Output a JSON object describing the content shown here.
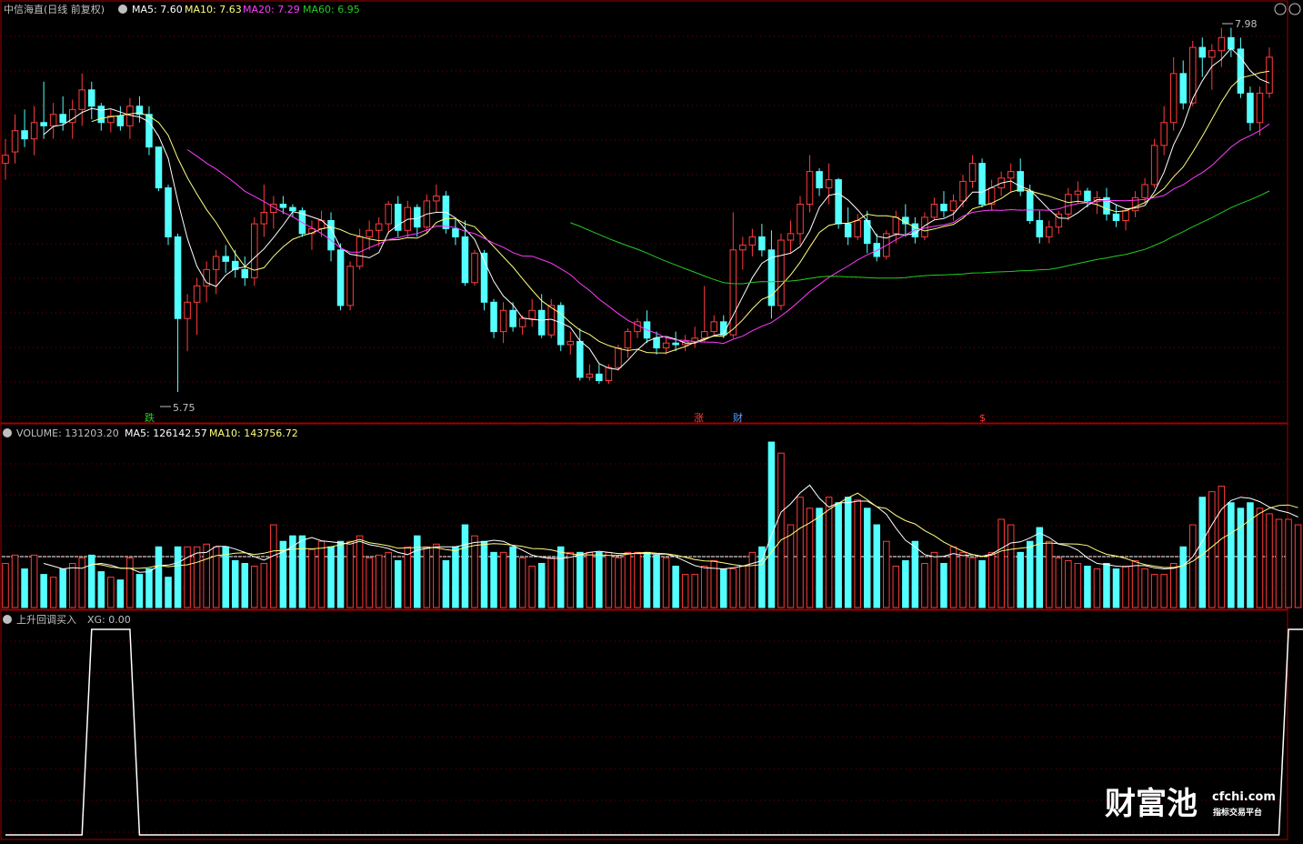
{
  "colors": {
    "up": "#ff3c3c",
    "down": "#54ffff",
    "ma5": "#ffffff",
    "ma10": "#ffff7f",
    "ma20": "#ff3cff",
    "ma60": "#22cc22",
    "frame": "#a00000",
    "grid": "#7a0000",
    "text_label": "#c0c0c0"
  },
  "price_panel": {
    "title": "中信海直(日线 前复权)",
    "legend": [
      {
        "name": "MA5",
        "text": "MA5: 7.60",
        "color": "#ffffff"
      },
      {
        "name": "MA10",
        "text": "MA10: 7.63",
        "color": "#ffff7f"
      },
      {
        "name": "MA20",
        "text": "MA20: 7.29",
        "color": "#ff3cff"
      },
      {
        "name": "MA60",
        "text": "MA60: 6.95",
        "color": "#22cc22"
      }
    ],
    "high_label": "7.98",
    "low_label": "5.75",
    "markers": [
      {
        "text": "跌",
        "color": "#22cc22"
      },
      {
        "text": "涨",
        "color": "#ff3c3c"
      },
      {
        "text": "财",
        "color": "#54a0ff"
      },
      {
        "text": "$",
        "color": "#ff3c3c"
      }
    ]
  },
  "volume_panel": {
    "legend": [
      {
        "name": "VOLUME",
        "text": "VOLUME: 131203.20",
        "color": "#c0c0c0"
      },
      {
        "name": "MA5",
        "text": "MA5: 126142.57",
        "color": "#ffffff"
      },
      {
        "name": "MA10",
        "text": "MA10: 143756.72",
        "color": "#ffff7f"
      }
    ]
  },
  "indicator_panel": {
    "legend": [
      {
        "name": "title",
        "text": "上升回调买入",
        "color": "#c0c0c0"
      },
      {
        "name": "XG",
        "text": "XG: 0.00",
        "color": "#c0c0c0"
      }
    ]
  },
  "watermark": {
    "brand": "财富池",
    "domain": "cfchi.com",
    "slogan": "指标交易平台"
  },
  "chart_data": [
    {
      "type": "candlestick",
      "title": "中信海直(日线 前复权)",
      "ylim": [
        5.6,
        8.05
      ],
      "up_color": "#ff3c3c",
      "down_color": "#54ffff",
      "ohlc": [
        [
          7.15,
          7.3,
          7.05,
          7.2
        ],
        [
          7.22,
          7.45,
          7.15,
          7.35
        ],
        [
          7.35,
          7.48,
          7.25,
          7.3
        ],
        [
          7.3,
          7.5,
          7.2,
          7.4
        ],
        [
          7.4,
          7.65,
          7.3,
          7.38
        ],
        [
          7.38,
          7.52,
          7.3,
          7.45
        ],
        [
          7.45,
          7.56,
          7.35,
          7.4
        ],
        [
          7.4,
          7.54,
          7.3,
          7.48
        ],
        [
          7.48,
          7.7,
          7.38,
          7.6
        ],
        [
          7.6,
          7.65,
          7.42,
          7.5
        ],
        [
          7.5,
          7.52,
          7.35,
          7.4
        ],
        [
          7.4,
          7.48,
          7.34,
          7.44
        ],
        [
          7.44,
          7.5,
          7.35,
          7.38
        ],
        [
          7.38,
          7.55,
          7.3,
          7.5
        ],
        [
          7.5,
          7.56,
          7.4,
          7.45
        ],
        [
          7.45,
          7.5,
          7.2,
          7.25
        ],
        [
          7.25,
          7.25,
          6.98,
          7.0
        ],
        [
          7.0,
          7.02,
          6.65,
          6.7
        ],
        [
          6.7,
          6.72,
          5.75,
          6.2
        ],
        [
          6.2,
          6.35,
          6.0,
          6.3
        ],
        [
          6.3,
          6.45,
          6.1,
          6.4
        ],
        [
          6.4,
          6.55,
          6.3,
          6.5
        ],
        [
          6.5,
          6.62,
          6.35,
          6.58
        ],
        [
          6.58,
          6.65,
          6.48,
          6.55
        ],
        [
          6.55,
          6.62,
          6.45,
          6.5
        ],
        [
          6.5,
          6.58,
          6.4,
          6.45
        ],
        [
          6.45,
          6.82,
          6.4,
          6.78
        ],
        [
          6.78,
          7.02,
          6.7,
          6.85
        ],
        [
          6.85,
          6.95,
          6.75,
          6.9
        ],
        [
          6.9,
          6.95,
          6.84,
          6.88
        ],
        [
          6.88,
          6.9,
          6.82,
          6.86
        ],
        [
          6.86,
          6.88,
          6.7,
          6.72
        ],
        [
          6.72,
          6.8,
          6.62,
          6.75
        ],
        [
          6.75,
          6.86,
          6.7,
          6.8
        ],
        [
          6.8,
          6.85,
          6.55,
          6.62
        ],
        [
          6.62,
          6.66,
          6.25,
          6.28
        ],
        [
          6.28,
          6.55,
          6.25,
          6.52
        ],
        [
          6.52,
          6.75,
          6.5,
          6.7
        ],
        [
          6.7,
          6.8,
          6.62,
          6.74
        ],
        [
          6.74,
          6.82,
          6.64,
          6.78
        ],
        [
          6.78,
          6.92,
          6.72,
          6.9
        ],
        [
          6.9,
          6.95,
          6.7,
          6.74
        ],
        [
          6.74,
          6.92,
          6.7,
          6.88
        ],
        [
          6.88,
          6.9,
          6.7,
          6.76
        ],
        [
          6.76,
          6.96,
          6.72,
          6.92
        ],
        [
          6.92,
          7.02,
          6.85,
          6.95
        ],
        [
          6.95,
          6.98,
          6.72,
          6.75
        ],
        [
          6.75,
          6.82,
          6.65,
          6.7
        ],
        [
          6.7,
          6.8,
          6.4,
          6.42
        ],
        [
          6.42,
          6.62,
          6.4,
          6.6
        ],
        [
          6.6,
          6.62,
          6.25,
          6.3
        ],
        [
          6.3,
          6.32,
          6.08,
          6.12
        ],
        [
          6.12,
          6.3,
          6.05,
          6.25
        ],
        [
          6.25,
          6.3,
          6.12,
          6.15
        ],
        [
          6.15,
          6.22,
          6.1,
          6.2
        ],
        [
          6.2,
          6.32,
          6.15,
          6.25
        ],
        [
          6.25,
          6.35,
          6.08,
          6.1
        ],
        [
          6.1,
          6.32,
          6.08,
          6.28
        ],
        [
          6.28,
          6.3,
          6.0,
          6.04
        ],
        [
          6.04,
          6.12,
          5.98,
          6.06
        ],
        [
          6.06,
          6.14,
          5.82,
          5.84
        ],
        [
          5.84,
          5.92,
          5.82,
          5.86
        ],
        [
          5.86,
          5.92,
          5.8,
          5.82
        ],
        [
          5.82,
          5.92,
          5.8,
          5.9
        ],
        [
          5.9,
          6.04,
          5.88,
          6.02
        ],
        [
          6.02,
          6.14,
          5.96,
          6.12
        ],
        [
          6.12,
          6.2,
          6.08,
          6.18
        ],
        [
          6.18,
          6.25,
          6.05,
          6.08
        ],
        [
          6.08,
          6.12,
          5.98,
          6.02
        ],
        [
          6.02,
          6.08,
          5.98,
          6.05
        ],
        [
          6.05,
          6.12,
          6.0,
          6.04
        ],
        [
          6.04,
          6.1,
          6.0,
          6.06
        ],
        [
          6.06,
          6.15,
          6.02,
          6.08
        ],
        [
          6.08,
          6.4,
          6.06,
          6.12
        ],
        [
          6.12,
          6.22,
          6.1,
          6.18
        ],
        [
          6.18,
          6.22,
          6.08,
          6.1
        ],
        [
          6.1,
          6.85,
          6.08,
          6.62
        ],
        [
          6.62,
          6.7,
          6.5,
          6.65
        ],
        [
          6.65,
          6.75,
          6.58,
          6.7
        ],
        [
          6.7,
          6.78,
          6.58,
          6.62
        ],
        [
          6.62,
          6.74,
          6.2,
          6.28
        ],
        [
          6.28,
          6.72,
          6.25,
          6.68
        ],
        [
          6.68,
          6.8,
          6.6,
          6.72
        ],
        [
          6.72,
          6.95,
          6.65,
          6.9
        ],
        [
          6.9,
          7.2,
          6.85,
          7.1
        ],
        [
          7.1,
          7.12,
          6.95,
          7.0
        ],
        [
          7.0,
          7.15,
          6.9,
          7.05
        ],
        [
          7.05,
          7.06,
          6.75,
          6.78
        ],
        [
          6.78,
          6.88,
          6.65,
          6.7
        ],
        [
          6.7,
          6.84,
          6.68,
          6.8
        ],
        [
          6.8,
          6.86,
          6.6,
          6.66
        ],
        [
          6.66,
          6.72,
          6.55,
          6.58
        ],
        [
          6.58,
          6.74,
          6.56,
          6.72
        ],
        [
          6.72,
          6.86,
          6.66,
          6.82
        ],
        [
          6.82,
          6.9,
          6.7,
          6.78
        ],
        [
          6.78,
          6.82,
          6.66,
          6.7
        ],
        [
          6.7,
          6.85,
          6.68,
          6.82
        ],
        [
          6.82,
          6.94,
          6.8,
          6.9
        ],
        [
          6.9,
          6.98,
          6.82,
          6.86
        ],
        [
          6.86,
          6.96,
          6.8,
          6.92
        ],
        [
          6.92,
          7.08,
          6.88,
          7.04
        ],
        [
          7.04,
          7.2,
          7.0,
          7.15
        ],
        [
          7.15,
          7.18,
          6.88,
          6.9
        ],
        [
          6.9,
          7.05,
          6.86,
          7.0
        ],
        [
          7.0,
          7.1,
          6.95,
          7.06
        ],
        [
          7.06,
          7.15,
          6.98,
          7.1
        ],
        [
          7.1,
          7.18,
          6.95,
          6.98
        ],
        [
          6.98,
          7.02,
          6.78,
          6.8
        ],
        [
          6.8,
          6.86,
          6.66,
          6.7
        ],
        [
          6.7,
          6.8,
          6.66,
          6.76
        ],
        [
          6.76,
          6.86,
          6.72,
          6.84
        ],
        [
          6.84,
          7.0,
          6.8,
          6.96
        ],
        [
          6.96,
          7.04,
          6.9,
          6.98
        ],
        [
          6.98,
          7.0,
          6.88,
          6.92
        ],
        [
          6.92,
          6.98,
          6.84,
          6.94
        ],
        [
          6.94,
          7.0,
          6.8,
          6.84
        ],
        [
          6.84,
          6.9,
          6.76,
          6.8
        ],
        [
          6.8,
          6.88,
          6.74,
          6.86
        ],
        [
          6.86,
          6.98,
          6.82,
          6.94
        ],
        [
          6.94,
          7.06,
          6.9,
          7.02
        ],
        [
          7.02,
          7.3,
          7.0,
          7.26
        ],
        [
          7.26,
          7.5,
          7.2,
          7.4
        ],
        [
          7.4,
          7.8,
          7.35,
          7.7
        ],
        [
          7.7,
          7.78,
          7.48,
          7.52
        ],
        [
          7.52,
          7.9,
          7.5,
          7.86
        ],
        [
          7.86,
          7.92,
          7.68,
          7.8
        ],
        [
          7.8,
          7.88,
          7.6,
          7.84
        ],
        [
          7.84,
          7.98,
          7.74,
          7.92
        ],
        [
          7.92,
          7.98,
          7.8,
          7.85
        ],
        [
          7.85,
          7.92,
          7.55,
          7.58
        ],
        [
          7.58,
          7.62,
          7.35,
          7.4
        ],
        [
          7.4,
          7.62,
          7.32,
          7.58
        ],
        [
          7.58,
          7.86,
          7.55,
          7.8
        ]
      ],
      "ma_periods": {
        "MA5": 5,
        "MA10": 10,
        "MA20": 20,
        "MA60": 60
      }
    },
    {
      "type": "bar",
      "title": "VOLUME",
      "ylim": [
        0,
        310000
      ],
      "values": [
        80000,
        95000,
        70000,
        95000,
        60000,
        55000,
        70000,
        80000,
        90000,
        95000,
        65000,
        55000,
        50000,
        90000,
        60000,
        70000,
        110000,
        55000,
        110000,
        110000,
        110000,
        115000,
        110000,
        110000,
        85000,
        80000,
        75000,
        80000,
        150000,
        120000,
        130000,
        130000,
        105000,
        120000,
        110000,
        120000,
        120000,
        130000,
        90000,
        95000,
        100000,
        85000,
        110000,
        130000,
        110000,
        115000,
        85000,
        110000,
        150000,
        130000,
        120000,
        100000,
        100000,
        110000,
        90000,
        75000,
        80000,
        90000,
        110000,
        100000,
        100000,
        100000,
        100000,
        100000,
        90000,
        100000,
        100000,
        100000,
        95000,
        90000,
        75000,
        60000,
        60000,
        75000,
        85000,
        70000,
        70000,
        75000,
        100000,
        110000,
        300000,
        280000,
        150000,
        200000,
        180000,
        180000,
        200000,
        190000,
        200000,
        195000,
        180000,
        150000,
        120000,
        75000,
        85000,
        120000,
        80000,
        100000,
        80000,
        110000,
        100000,
        90000,
        85000,
        100000,
        160000,
        150000,
        100000,
        120000,
        145000,
        120000,
        90000,
        85000,
        80000,
        75000,
        70000,
        80000,
        70000,
        75000,
        85000,
        70000,
        60000,
        60000,
        80000,
        110000,
        150000,
        200000,
        210000,
        220000,
        190000,
        180000,
        190000,
        180000,
        170000,
        160000,
        160000,
        150000
      ],
      "ma_periods": {
        "MA5": 5,
        "MA10": 10
      }
    },
    {
      "type": "line",
      "title": "上升回调买入",
      "name": "XG",
      "ylim": [
        0,
        1
      ],
      "values": [
        0,
        0,
        0,
        0,
        0,
        0,
        0,
        0,
        0,
        1,
        1,
        1,
        1,
        1,
        0,
        0,
        0,
        0,
        0,
        0,
        0,
        0,
        0,
        0,
        0,
        0,
        0,
        0,
        0,
        0,
        0,
        0,
        0,
        0,
        0,
        0,
        0,
        0,
        0,
        0,
        0,
        0,
        0,
        0,
        0,
        0,
        0,
        0,
        0,
        0,
        0,
        0,
        0,
        0,
        0,
        0,
        0,
        0,
        0,
        0,
        0,
        0,
        0,
        0,
        0,
        0,
        0,
        0,
        0,
        0,
        0,
        0,
        0,
        0,
        0,
        0,
        0,
        0,
        0,
        0,
        0,
        0,
        0,
        0,
        0,
        0,
        0,
        0,
        0,
        0,
        0,
        0,
        0,
        0,
        0,
        0,
        0,
        0,
        0,
        0,
        0,
        0,
        0,
        0,
        0,
        0,
        0,
        0,
        0,
        0,
        0,
        0,
        0,
        0,
        0,
        0,
        0,
        0,
        0,
        0,
        0,
        0,
        0,
        0,
        0,
        0,
        0,
        0,
        0,
        0,
        0,
        0,
        0,
        0,
        1,
        1,
        1,
        1,
        0
      ]
    }
  ]
}
